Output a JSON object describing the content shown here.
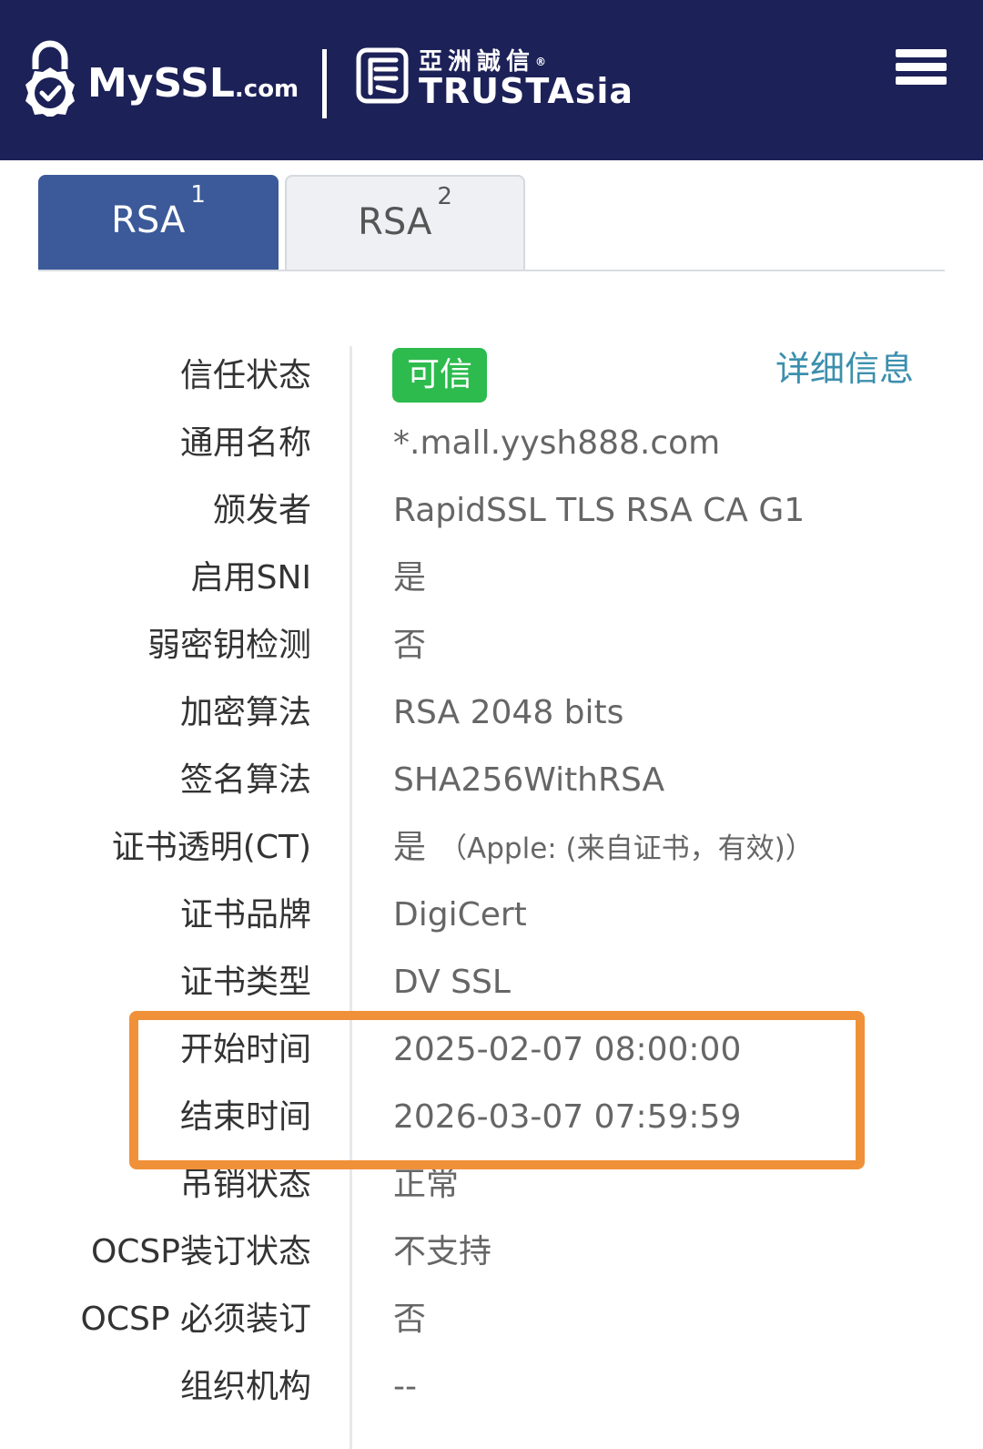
{
  "header": {
    "brand_main": "MySSL",
    "brand_suffix": ".com",
    "partner_cn": "亞洲誠信",
    "partner_en": "TRUSTAsia",
    "partner_mark": "®",
    "bg_color": "#1c2158"
  },
  "tabs": [
    {
      "label": "RSA",
      "index": "1",
      "active": true
    },
    {
      "label": "RSA",
      "index": "2",
      "active": false
    }
  ],
  "trust": {
    "label": "信任状态",
    "badge": "可信",
    "badge_color": "#2dbb4e",
    "detail_link": "详细信息"
  },
  "rows": [
    {
      "label": "通用名称",
      "value": "*.mall.yysh888.com"
    },
    {
      "label": "颁发者",
      "value": "RapidSSL TLS RSA CA G1"
    },
    {
      "label": "启用SNI",
      "value": "是"
    },
    {
      "label": "弱密钥检测",
      "value": "否"
    },
    {
      "label": "加密算法",
      "value": "RSA 2048 bits"
    },
    {
      "label": "签名算法",
      "value": "SHA256WithRSA"
    },
    {
      "label": "证书透明(CT)",
      "value": "是",
      "note": "（Apple: (来自证书，有效)）"
    },
    {
      "label": "证书品牌",
      "value": "DigiCert"
    },
    {
      "label": "证书类型",
      "value": "DV SSL"
    },
    {
      "label": "开始时间",
      "value": "2025-02-07 08:00:00"
    },
    {
      "label": "结束时间",
      "value": "2026-03-07 07:59:59"
    },
    {
      "label": "吊销状态",
      "value": "正常"
    },
    {
      "label": "OCSP装订状态",
      "value": "不支持"
    },
    {
      "label": "OCSP 必须装订",
      "value": "否"
    },
    {
      "label": "组织机构",
      "value": "--"
    }
  ],
  "highlight_color": "#f0913a"
}
